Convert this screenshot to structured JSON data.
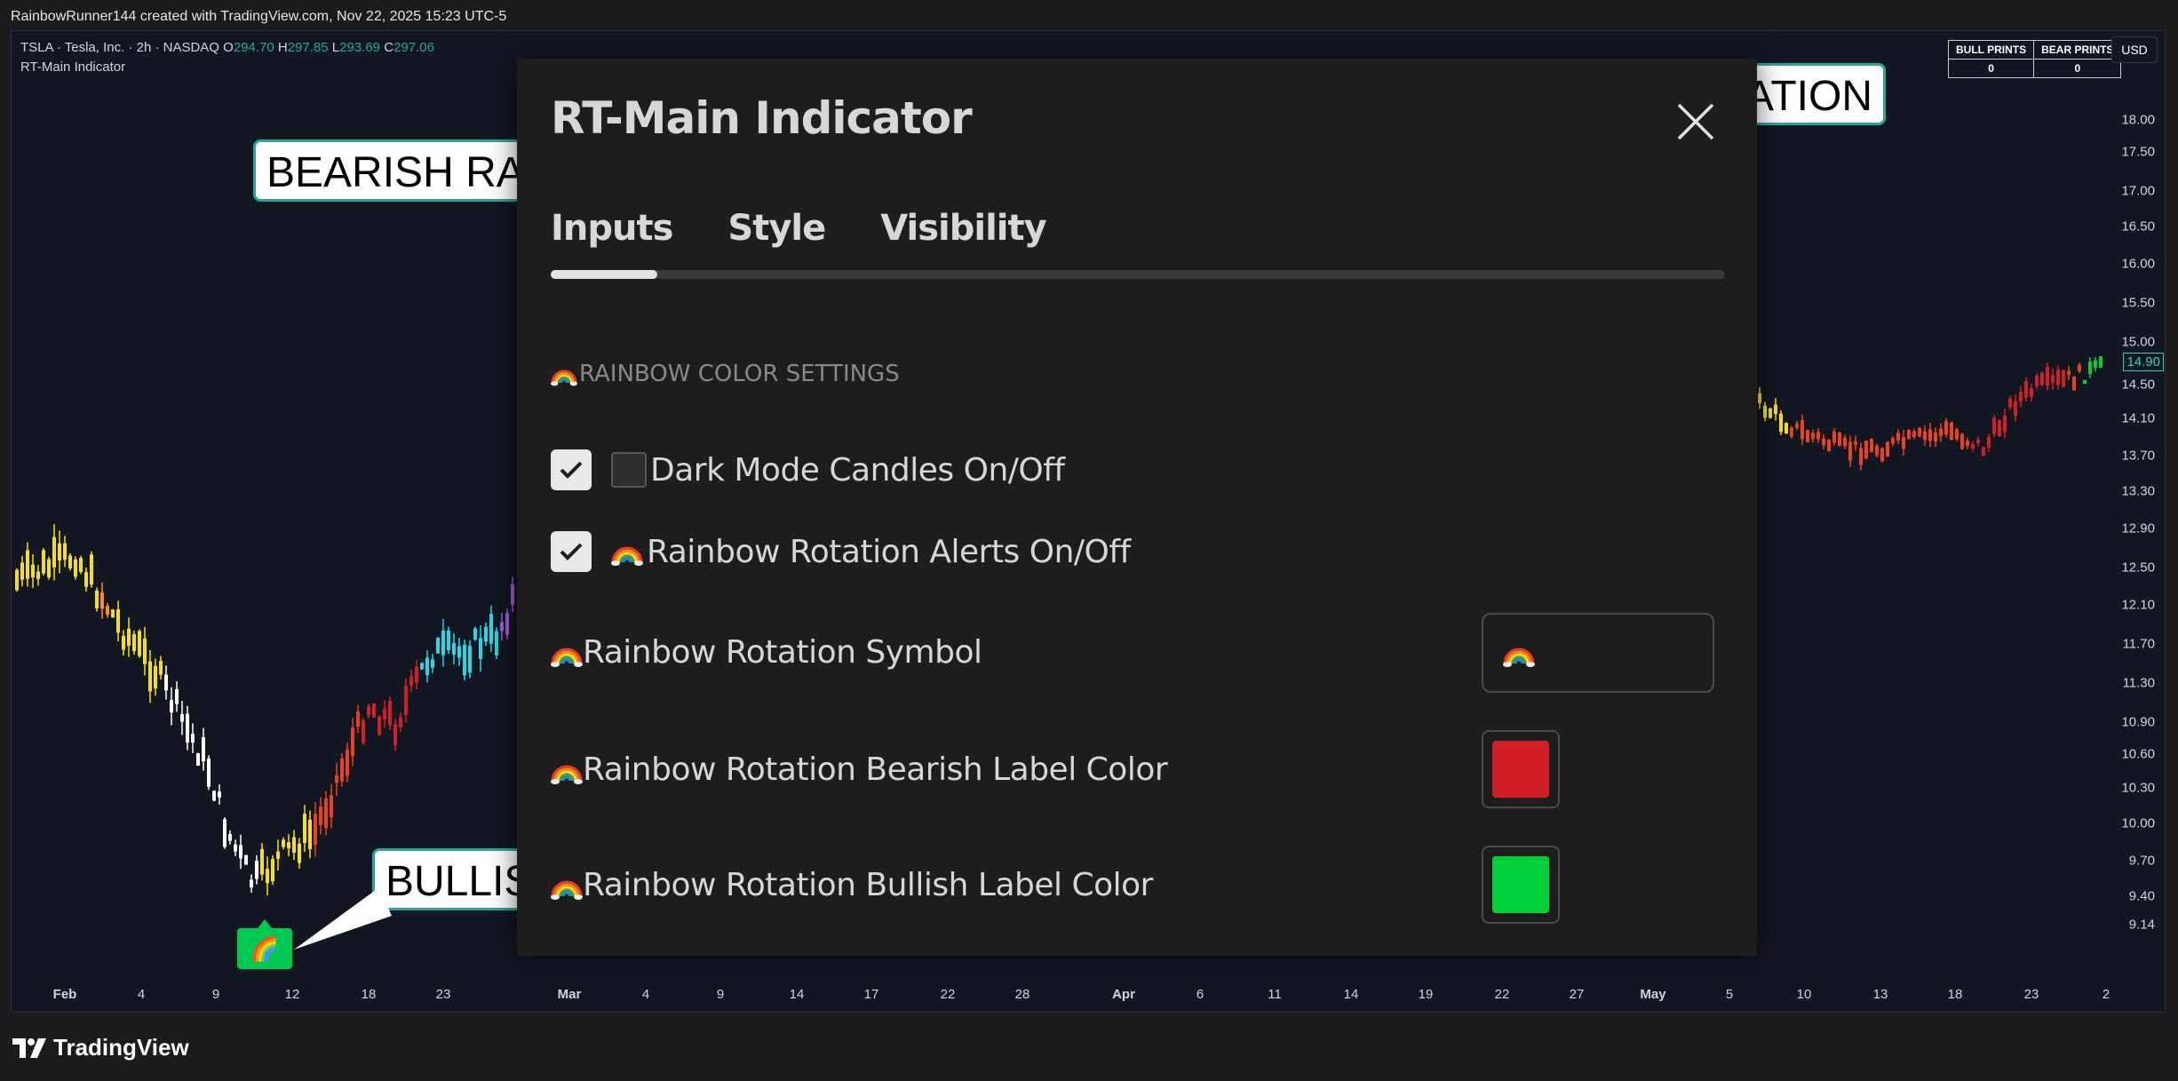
{
  "header": {
    "credit": "RainbowRunner144 created with TradingView.com, Nov 22, 2025 15:23 UTC-5"
  },
  "legend": {
    "symbol": "TSLA · Tesla, Inc. · 2h · NASDAQ",
    "o_label": "O",
    "o": "294.70",
    "h_label": "H",
    "h": "297.85",
    "l_label": "L",
    "l": "293.69",
    "c_label": "C",
    "c": "297.06",
    "indicator": "RT-Main Indicator"
  },
  "prints": {
    "bull_header": "BULL PRINTS",
    "bear_header": "BEAR PRINTS",
    "bull_value": "0",
    "bear_value": "0"
  },
  "currency": "USD",
  "price_axis": {
    "ticks": [
      "18.00",
      "17.50",
      "17.00",
      "16.50",
      "16.00",
      "15.50",
      "15.00",
      "14.50",
      "14.10",
      "13.70",
      "13.30",
      "12.90",
      "12.50",
      "12.10",
      "11.70",
      "11.30",
      "10.90",
      "10.60",
      "10.30",
      "10.00",
      "9.70",
      "9.40",
      "9.14"
    ],
    "last_price": "14.90"
  },
  "time_axis": {
    "ticks": [
      "Feb",
      "4",
      "9",
      "12",
      "18",
      "23",
      "Mar",
      "4",
      "9",
      "14",
      "17",
      "22",
      "28",
      "Apr",
      "6",
      "11",
      "14",
      "19",
      "22",
      "27",
      "May",
      "5",
      "10",
      "13",
      "18",
      "23",
      "2"
    ]
  },
  "callouts": {
    "bearish": "BEARISH RAINBOW ROTATION",
    "bullish": "BULLISH RAINBOW ROTATION",
    "top_right": "RAINBOW ROTATION"
  },
  "bullish_marker": {
    "symbol": "🌈"
  },
  "dialog": {
    "title": "RT-Main Indicator",
    "tabs": [
      {
        "label": "Inputs"
      },
      {
        "label": "Style"
      },
      {
        "label": "Visibility"
      }
    ],
    "active_tab": "Inputs",
    "section": "RAINBOW COLOR SETTINGS",
    "rows": {
      "dark_mode": {
        "label": "Dark Mode Candles On/Off",
        "checked": true
      },
      "alerts": {
        "label": "Rainbow Rotation Alerts On/Off",
        "checked": true
      },
      "symbol": {
        "label": "Rainbow Rotation Symbol",
        "value": "🌈"
      },
      "bearish_color": {
        "label": "Rainbow Rotation Bearish Label Color",
        "color": "#d32027"
      },
      "bullish_color": {
        "label": "Rainbow Rotation Bullish Label Color",
        "color": "#00d13b"
      }
    }
  },
  "footer": {
    "brand": "TradingView"
  }
}
